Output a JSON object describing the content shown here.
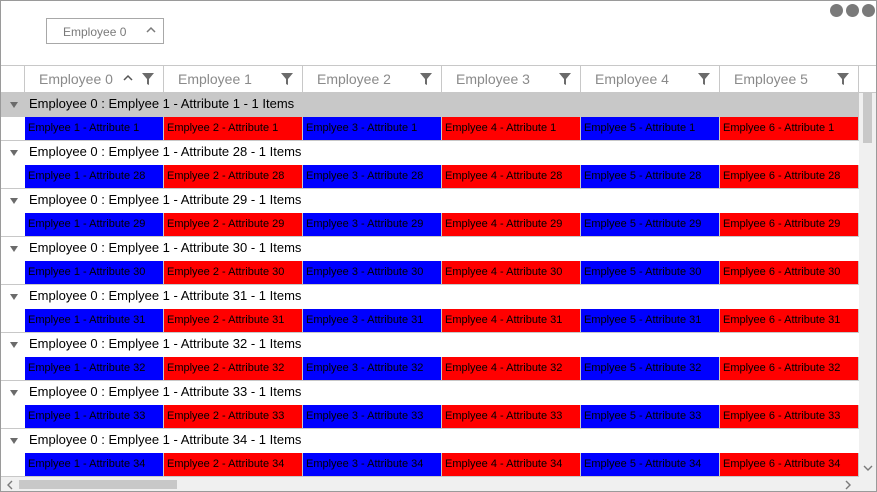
{
  "group_panel": {
    "chip_label": "Employee 0"
  },
  "columns": [
    {
      "label": "Employee 0",
      "sorted": "ascending"
    },
    {
      "label": "Employee 1"
    },
    {
      "label": "Employee 2"
    },
    {
      "label": "Employee 3"
    },
    {
      "label": "Employee 4"
    },
    {
      "label": "Employee 5"
    }
  ],
  "colors": {
    "blue": "#0000ff",
    "red": "#ff0000",
    "selected_group": "#c8c8c8"
  },
  "groups": [
    {
      "header": "Employee 0 : Emplyee 1 - Attribute 1 - 1 Items",
      "selected": true,
      "cells": [
        "Emplyee 1 - Attribute 1",
        "Emplyee 2 - Attribute 1",
        "Emplyee 3 - Attribute 1",
        "Emplyee 4 - Attribute 1",
        "Emplyee 5 - Attribute 1",
        "Emplyee 6 - Attribute 1"
      ]
    },
    {
      "header": "Employee 0 : Emplyee 1 - Attribute 28 - 1 Items",
      "cells": [
        "Emplyee 1 - Attribute 28",
        "Emplyee 2 - Attribute 28",
        "Emplyee 3 - Attribute 28",
        "Emplyee 4 - Attribute 28",
        "Emplyee 5 - Attribute 28",
        "Emplyee 6 - Attribute 28"
      ]
    },
    {
      "header": "Employee 0 : Emplyee 1 - Attribute 29 - 1 Items",
      "cells": [
        "Emplyee 1 - Attribute 29",
        "Emplyee 2 - Attribute 29",
        "Emplyee 3 - Attribute 29",
        "Emplyee 4 - Attribute 29",
        "Emplyee 5 - Attribute 29",
        "Emplyee 6 - Attribute 29"
      ]
    },
    {
      "header": "Employee 0 : Emplyee 1 - Attribute 30 - 1 Items",
      "cells": [
        "Emplyee 1 - Attribute 30",
        "Emplyee 2 - Attribute 30",
        "Emplyee 3 - Attribute 30",
        "Emplyee 4 - Attribute 30",
        "Emplyee 5 - Attribute 30",
        "Emplyee 6 - Attribute 30"
      ]
    },
    {
      "header": "Employee 0 : Emplyee 1 - Attribute 31 - 1 Items",
      "cells": [
        "Emplyee 1 - Attribute 31",
        "Emplyee 2 - Attribute 31",
        "Emplyee 3 - Attribute 31",
        "Emplyee 4 - Attribute 31",
        "Emplyee 5 - Attribute 31",
        "Emplyee 6 - Attribute 31"
      ]
    },
    {
      "header": "Employee 0 : Emplyee 1 - Attribute 32 - 1 Items",
      "cells": [
        "Emplyee 1 - Attribute 32",
        "Emplyee 2 - Attribute 32",
        "Emplyee 3 - Attribute 32",
        "Emplyee 4 - Attribute 32",
        "Emplyee 5 - Attribute 32",
        "Emplyee 6 - Attribute 32"
      ]
    },
    {
      "header": "Employee 0 : Emplyee 1 - Attribute 33 - 1 Items",
      "cells": [
        "Emplyee 1 - Attribute 33",
        "Emplyee 2 - Attribute 33",
        "Emplyee 3 - Attribute 33",
        "Emplyee 4 - Attribute 33",
        "Emplyee 5 - Attribute 33",
        "Emplyee 6 - Attribute 33"
      ]
    },
    {
      "header": "Employee 0 : Emplyee 1 - Attribute 34 - 1 Items",
      "cells": [
        "Emplyee 1 - Attribute 34",
        "Emplyee 2 - Attribute 34",
        "Emplyee 3 - Attribute 34",
        "Emplyee 4 - Attribute 34",
        "Emplyee 5 - Attribute 34",
        "Emplyee 6 - Attribute 34"
      ]
    }
  ]
}
